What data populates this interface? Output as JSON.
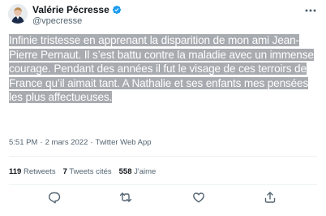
{
  "header": {
    "display_name": "Valérie Pécresse",
    "handle": "@vpecresse",
    "verified_icon": "verified-badge-icon",
    "more_icon": "more-options-icon"
  },
  "tweet": {
    "text": "Infinie tristesse en apprenant la disparition de mon ami Jean-Pierre Pernaut. Il s’est battu contre la maladie avec un immense courage. Pendant des années il fut le visage de ces terroirs de France qu’il aimait tant. A Nathalie et ses enfants mes pensées les plus affectueuses."
  },
  "meta": {
    "time": "5:51 PM",
    "separator": "·",
    "date": "2 mars 2022",
    "source": "Twitter Web App"
  },
  "stats": {
    "retweets_count": "119",
    "retweets_label": "Retweets",
    "quotes_count": "7",
    "quotes_label": "Tweets cités",
    "likes_count": "558",
    "likes_label": "J'aime"
  },
  "actions": [
    "reply-icon",
    "retweet-icon",
    "like-icon",
    "share-icon"
  ],
  "colors": {
    "verified": "#1d9bf0",
    "secondary_text": "#536471",
    "highlight": "#a8abb0",
    "divider": "#eff3f4"
  }
}
